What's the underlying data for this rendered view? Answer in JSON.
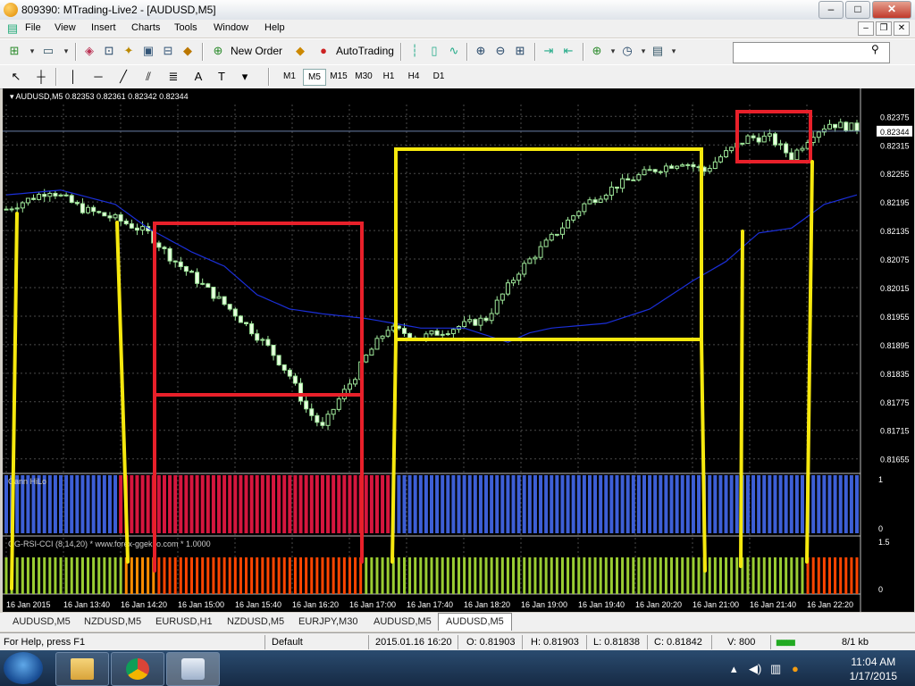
{
  "window": {
    "title": "809390: MTrading-Live2 - [AUDUSD,M5]"
  },
  "menu": [
    "File",
    "View",
    "Insert",
    "Charts",
    "Tools",
    "Window",
    "Help"
  ],
  "toolbar": {
    "new_order": "New Order",
    "auto_trading": "AutoTrading",
    "search_placeholder": ""
  },
  "timeframes": [
    "M1",
    "M5",
    "M15",
    "M30",
    "H1",
    "H4",
    "D1"
  ],
  "active_timeframe": "M5",
  "chart_data": {
    "type": "candlestick",
    "header": "AUDUSD,M5  0.82353 0.82361 0.82342 0.82344",
    "current_price": "0.82344",
    "y_ticks": [
      "0.82375",
      "0.82315",
      "0.82255",
      "0.82195",
      "0.82135",
      "0.82075",
      "0.82015",
      "0.81955",
      "0.81895",
      "0.81835",
      "0.81775",
      "0.81715",
      "0.81655"
    ],
    "ylim": [
      0.8163,
      0.824
    ],
    "x_ticks": [
      "16 Jan 2015",
      "16 Jan 13:40",
      "16 Jan 14:20",
      "16 Jan 15:00",
      "16 Jan 15:40",
      "16 Jan 16:20",
      "16 Jan 17:00",
      "16 Jan 17:40",
      "16 Jan 18:20",
      "16 Jan 19:00",
      "16 Jan 19:40",
      "16 Jan 20:20",
      "16 Jan 21:00",
      "16 Jan 21:40",
      "16 Jan 22:20"
    ],
    "path_points": [
      [
        0,
        0.8218
      ],
      [
        8,
        0.8222
      ],
      [
        14,
        0.8218
      ],
      [
        20,
        0.8216
      ],
      [
        26,
        0.8213
      ],
      [
        30,
        0.8208
      ],
      [
        36,
        0.8202
      ],
      [
        42,
        0.8196
      ],
      [
        48,
        0.8189
      ],
      [
        52,
        0.8183
      ],
      [
        55,
        0.8176
      ],
      [
        58,
        0.8172
      ],
      [
        61,
        0.8178
      ],
      [
        64,
        0.8183
      ],
      [
        66,
        0.8187
      ],
      [
        70,
        0.8193
      ],
      [
        76,
        0.8191
      ],
      [
        82,
        0.8193
      ],
      [
        88,
        0.8195
      ],
      [
        94,
        0.8205
      ],
      [
        100,
        0.8212
      ],
      [
        106,
        0.8219
      ],
      [
        112,
        0.8223
      ],
      [
        118,
        0.8226
      ],
      [
        124,
        0.8228
      ],
      [
        128,
        0.8226
      ],
      [
        131,
        0.8229
      ],
      [
        136,
        0.8233
      ],
      [
        140,
        0.8233
      ],
      [
        144,
        0.8229
      ],
      [
        148,
        0.8234
      ],
      [
        151,
        0.8236
      ],
      [
        156,
        0.8235
      ]
    ],
    "indicator_line": [
      [
        0,
        0.8221
      ],
      [
        10,
        0.8222
      ],
      [
        20,
        0.8219
      ],
      [
        26,
        0.8214
      ],
      [
        34,
        0.8209
      ],
      [
        40,
        0.8206
      ],
      [
        46,
        0.82
      ],
      [
        52,
        0.8197
      ],
      [
        58,
        0.8196
      ],
      [
        66,
        0.8195
      ],
      [
        76,
        0.8193
      ],
      [
        84,
        0.8193
      ],
      [
        92,
        0.819
      ],
      [
        96,
        0.8192
      ],
      [
        100,
        0.8193
      ],
      [
        110,
        0.8194
      ],
      [
        118,
        0.8197
      ],
      [
        122,
        0.82
      ],
      [
        126,
        0.8203
      ],
      [
        132,
        0.8207
      ],
      [
        138,
        0.8213
      ],
      [
        144,
        0.8214
      ],
      [
        150,
        0.8219
      ],
      [
        156,
        0.8221
      ]
    ],
    "indicator1": {
      "label": "Gann HiLo",
      "scale_top": "1",
      "scale_bottom": "0",
      "segments": [
        {
          "color": "blue",
          "from": 0,
          "to": 21
        },
        {
          "color": "red",
          "from": 21,
          "to": 71
        },
        {
          "color": "blue",
          "from": 71,
          "to": 156
        }
      ]
    },
    "indicator2": {
      "label": "GG-RSI-CCI (8,14,20) * www.forex-ggekko.com * 1.0000",
      "scale_top": "1.5",
      "scale_bottom": "0",
      "segments": [
        {
          "color": "green",
          "from": 0,
          "to": 22
        },
        {
          "color": "orange",
          "from": 22,
          "to": 28
        },
        {
          "color": "red",
          "from": 28,
          "to": 66
        },
        {
          "color": "green",
          "from": 66,
          "to": 147
        },
        {
          "color": "red",
          "from": 147,
          "to": 156
        }
      ]
    },
    "colors": {
      "bull": "#c8f0c0",
      "bear": "#d8f8d0",
      "line": "#1b2fd8",
      "blue": "#3d5fd6",
      "red": "#d6163e",
      "green": "#9acd32",
      "orange": "#ff8c00",
      "redbar": "#ff4500",
      "yellow": "#f6e80e",
      "redbox": "#e8202a"
    }
  },
  "tabs": [
    "AUDUSD,M5",
    "NZDUSD,M5",
    "EURUSD,H1",
    "NZDUSD,M5",
    "EURJPY,M30",
    "AUDUSD,M5",
    "AUDUSD,M5"
  ],
  "active_tab": 6,
  "status": {
    "help": "For Help, press F1",
    "profile": "Default",
    "datetime": "2015.01.16 16:20",
    "open": "O: 0.81903",
    "high": "H: 0.81903",
    "low": "L: 0.81838",
    "close": "C: 0.81842",
    "volume": "V: 800",
    "traffic": "8/1 kb"
  },
  "taskbar": {
    "time": "11:04 AM",
    "date": "1/17/2015"
  }
}
